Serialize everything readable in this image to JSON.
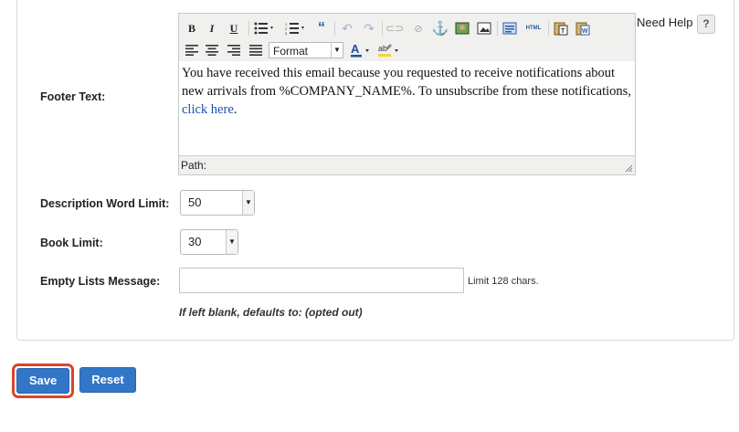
{
  "help": {
    "label": "Need Help",
    "icon_glyph": "?"
  },
  "editor": {
    "label": "Footer Text:",
    "format_value": "Format",
    "content_text": "You have received this email because you requested to receive notifications about new arrivals from %COMPANY_NAME%. To unsubscribe from these notifications, ",
    "content_link": "click here",
    "content_end": ".",
    "path_label": "Path:",
    "toolbar_icons": [
      "bold-icon",
      "italic-icon",
      "underline-icon",
      "bullet-list-icon",
      "numbered-list-icon",
      "blockquote-icon",
      "undo-icon",
      "redo-icon",
      "link-icon",
      "unlink-icon",
      "anchor-icon",
      "image-icon",
      "picture-icon",
      "source-icon",
      "html-icon",
      "paste-text-icon",
      "paste-word-icon",
      "align-left-icon",
      "align-center-icon",
      "align-right-icon",
      "justify-icon",
      "text-color-icon",
      "highlight-icon"
    ]
  },
  "fields": {
    "desc_limit": {
      "label": "Description Word Limit:",
      "value": "50"
    },
    "book_limit": {
      "label": "Book Limit:",
      "value": "30"
    },
    "empty_msg": {
      "label": "Empty Lists Message:",
      "value": "",
      "limit_note": "Limit 128 chars.",
      "hint": "If left blank, defaults to: (opted out)"
    }
  },
  "buttons": {
    "save": "Save",
    "reset": "Reset"
  },
  "colors": {
    "button_blue": "#3276c8",
    "highlight_red": "#d9452a",
    "link_blue": "#1d4fb0"
  }
}
